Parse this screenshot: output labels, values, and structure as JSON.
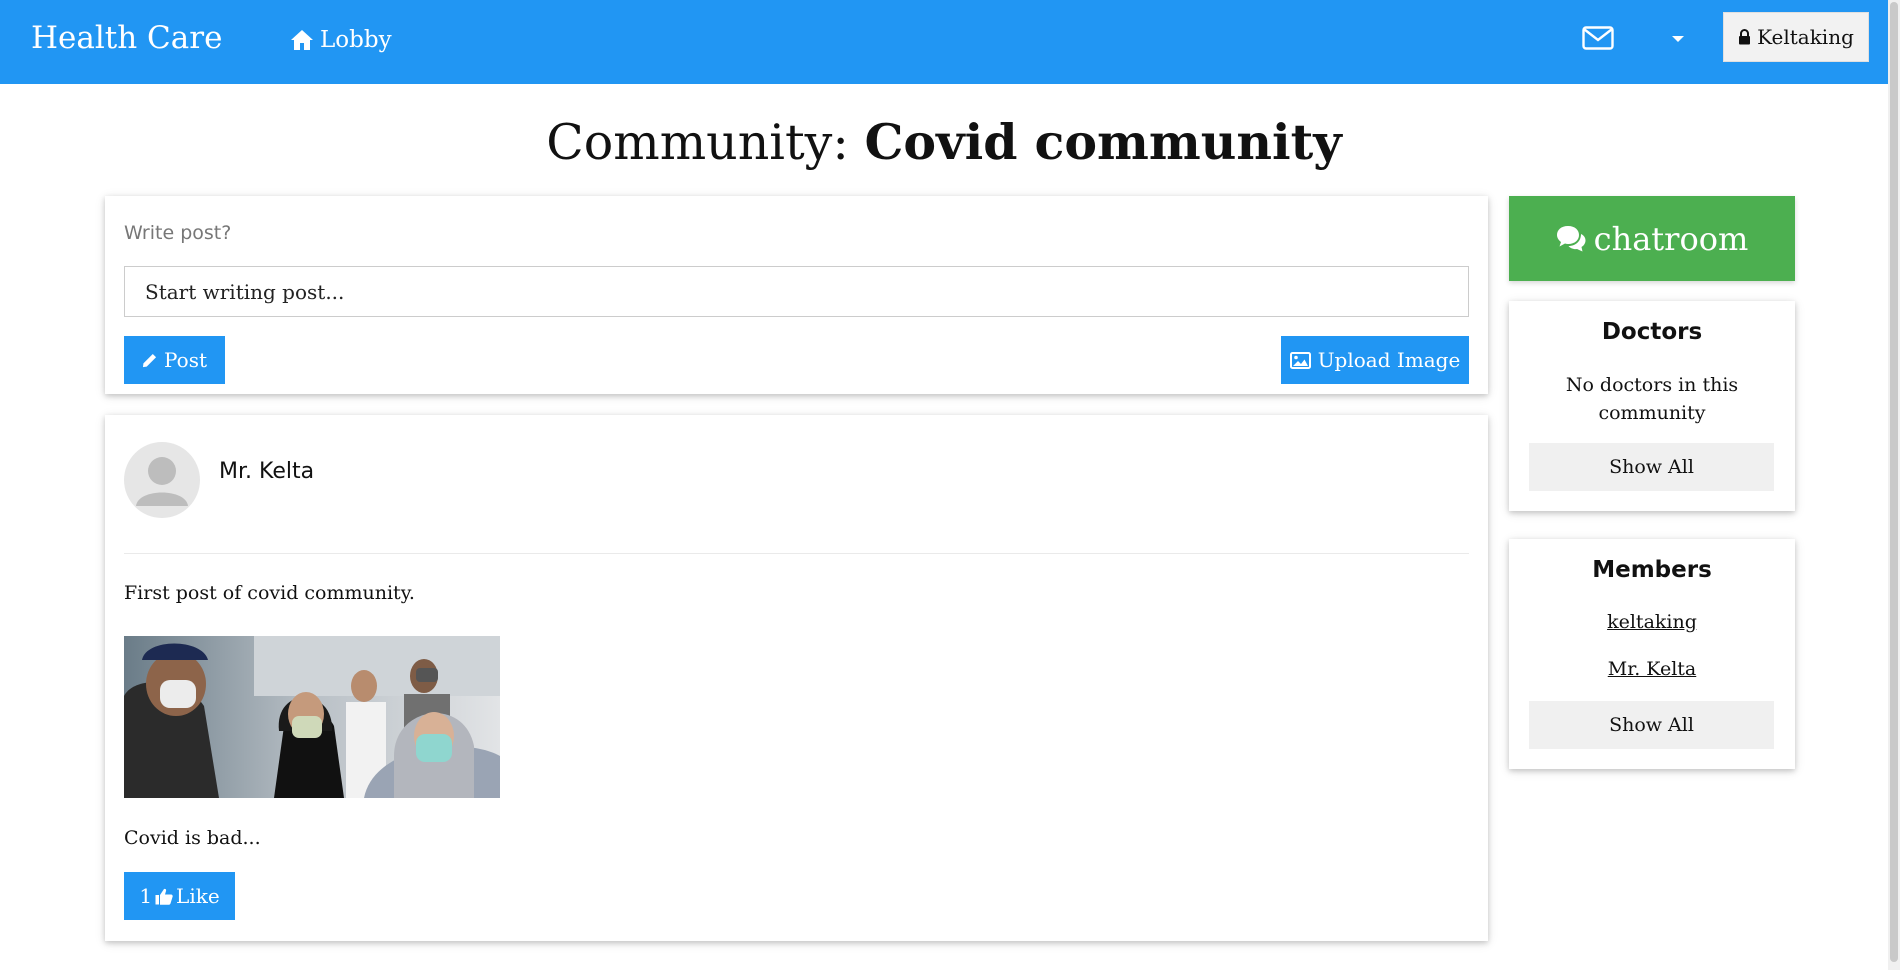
{
  "navbar": {
    "brand": "Health Care",
    "lobby_label": "Lobby",
    "user_label": "Keltaking",
    "background": "#2196f3"
  },
  "page": {
    "title_prefix": "Community: ",
    "community_name": "Covid community"
  },
  "composer": {
    "label": "Write post?",
    "input_placeholder": "Start writing post...",
    "post_button": "Post",
    "upload_button": "Upload Image"
  },
  "post": {
    "author": "Mr. Kelta",
    "text": "First post of covid community.",
    "image_alt": "People wearing face masks",
    "caption": "Covid is bad...",
    "like_count": "1",
    "like_label": "Like"
  },
  "sidebar": {
    "chatroom_label": "chatroom",
    "doctors": {
      "heading": "Doctors",
      "empty_text": "No doctors in this community",
      "show_all": "Show All"
    },
    "members": {
      "heading": "Members",
      "items": [
        "keltaking",
        "Mr. Kelta"
      ],
      "show_all": "Show All"
    }
  },
  "colors": {
    "primary": "#2196f3",
    "success": "#4caf50",
    "light_button": "#f0f0f0"
  },
  "icons": {
    "lobby": "home-icon",
    "mail": "envelope-icon",
    "dropdown": "caret-down-icon",
    "user": "lock-icon",
    "post": "pencil-icon",
    "upload": "image-icon",
    "like": "thumbs-up-icon",
    "chatroom": "comments-icon"
  }
}
